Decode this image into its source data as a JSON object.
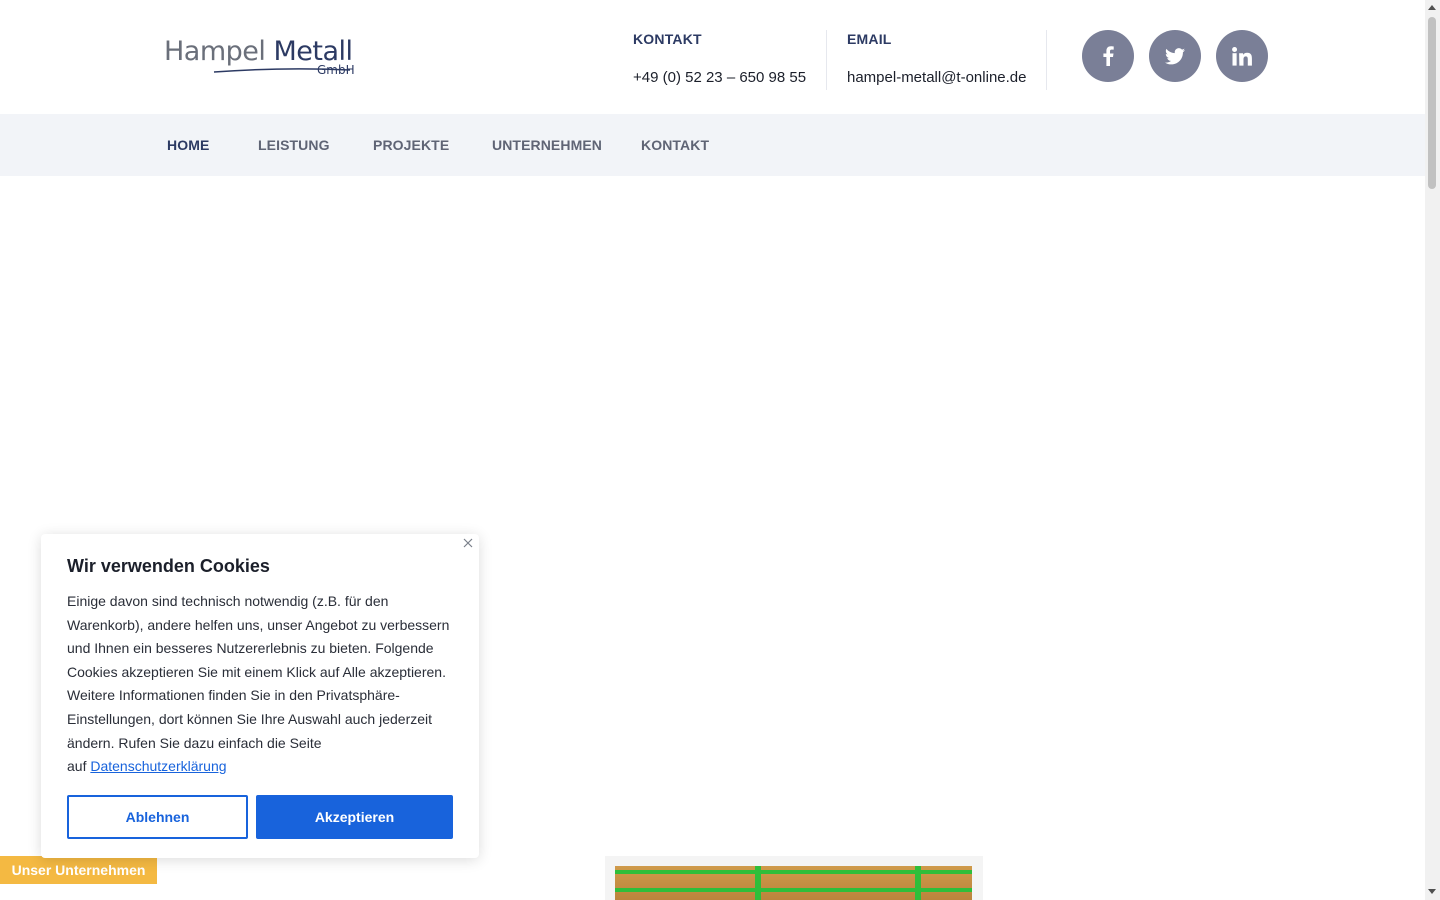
{
  "logo": {
    "word1": "Hampel",
    "word2": "Metall",
    "suffix": "GmbH"
  },
  "header": {
    "phone": {
      "label": "KONTAKT",
      "value": "+49 (0) 52 23 – 650 98 55"
    },
    "email": {
      "label": "EMAIL",
      "value": "hampel-metall@t-online.de"
    },
    "social": [
      {
        "name": "facebook-icon",
        "glyph": "f"
      },
      {
        "name": "twitter-icon",
        "glyph": "bird"
      },
      {
        "name": "linkedin-icon",
        "glyph": "in"
      }
    ]
  },
  "nav": {
    "items": [
      {
        "label": "HOME",
        "active": true
      },
      {
        "label": "LEISTUNG",
        "active": false
      },
      {
        "label": "PROJEKTE",
        "active": false
      },
      {
        "label": "UNTERNEHMEN",
        "active": false
      },
      {
        "label": "KONTAKT",
        "active": false
      }
    ]
  },
  "cookie": {
    "title": "Wir verwenden Cookies",
    "body": "Einige davon sind technisch notwendig (z.B. für den Warenkorb), andere helfen uns, unser Angebot zu verbessern und Ihnen ein besseres Nutzererlebnis zu bieten. Folgende Cookies akzeptieren Sie mit einem Klick auf Alle akzeptieren. Weitere Informationen finden Sie in den Privatsphäre-Einstellungen, dort können Sie Ihre Auswahl auch jederzeit ändern. Rufen Sie dazu einfach die Seite",
    "link_prefix": "auf",
    "link_text": "Datenschutzerklärung",
    "reject_label": "Ablehnen",
    "accept_label": "Akzeptieren"
  },
  "badge": {
    "label": "Unser Unternehmen"
  },
  "colors": {
    "brand_navy": "#2c3a63",
    "accent_blue": "#1863dc",
    "badge_yellow": "#f4b942",
    "social_grey": "#7a7f97"
  }
}
